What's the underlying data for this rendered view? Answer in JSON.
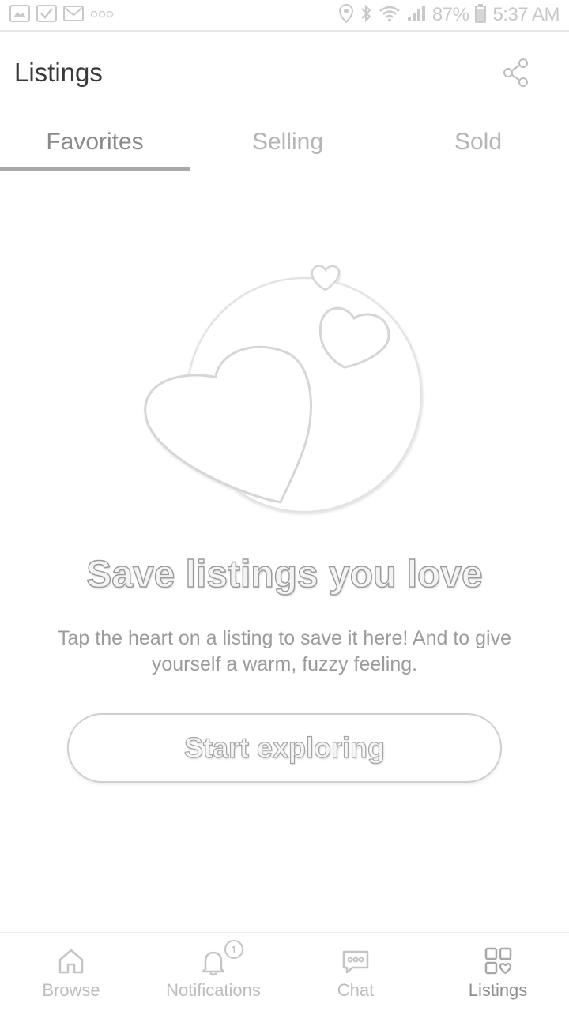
{
  "status_bar": {
    "battery": "87%",
    "time": "5:37 AM"
  },
  "header": {
    "title": "Listings",
    "share_icon": "share-icon"
  },
  "tabs": [
    {
      "label": "Favorites",
      "active": true
    },
    {
      "label": "Selling",
      "active": false
    },
    {
      "label": "Sold",
      "active": false
    }
  ],
  "empty_state": {
    "illustration": "hearts-illustration",
    "heading": "Save listings you love",
    "body": "Tap the heart on a listing to save it here! And to give yourself a warm, fuzzy feeling.",
    "button_label": "Start exploring"
  },
  "bottom_nav": {
    "items": [
      {
        "label": "Browse",
        "icon": "home-icon",
        "active": false
      },
      {
        "label": "Notifications",
        "icon": "bell-icon",
        "active": false,
        "badge": "1"
      },
      {
        "label": "Chat",
        "icon": "chat-bubble-icon",
        "active": false
      },
      {
        "label": "Listings",
        "icon": "listings-grid-icon",
        "active": true
      }
    ]
  },
  "colors": {
    "text_primary": "#3a3a3a",
    "text_muted": "#9b9b9b",
    "tab_indicator": "#a9a9a9",
    "border": "#cfcfcf"
  }
}
